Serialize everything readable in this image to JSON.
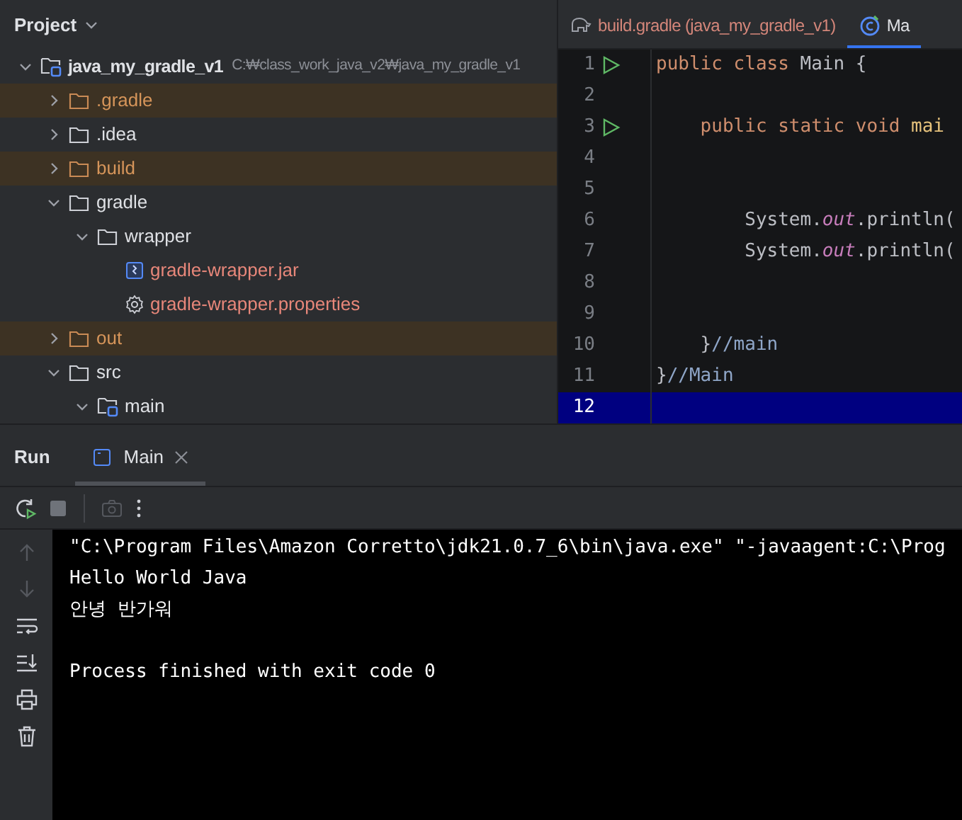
{
  "project_panel": {
    "title": "Project",
    "tree": [
      {
        "name": "java_my_gradle_v1",
        "kind": "module",
        "path": "C:₩class_work_java_v2₩java_my_gradle_v1",
        "excluded": false,
        "expanded": true,
        "children": [
          {
            "name": ".gradle",
            "kind": "folder",
            "excluded": true,
            "expanded": false
          },
          {
            "name": ".idea",
            "kind": "folder",
            "excluded": false,
            "expanded": false
          },
          {
            "name": "build",
            "kind": "folder",
            "excluded": true,
            "expanded": false
          },
          {
            "name": "gradle",
            "kind": "folder",
            "excluded": false,
            "expanded": true,
            "children": [
              {
                "name": "wrapper",
                "kind": "folder",
                "excluded": false,
                "expanded": true,
                "children": [
                  {
                    "name": "gradle-wrapper.jar",
                    "kind": "jar",
                    "excluded": false,
                    "unversioned": true
                  },
                  {
                    "name": "gradle-wrapper.properties",
                    "kind": "properties",
                    "excluded": false,
                    "unversioned": true
                  }
                ]
              }
            ]
          },
          {
            "name": "out",
            "kind": "folder",
            "excluded": true,
            "expanded": false
          },
          {
            "name": "src",
            "kind": "folder",
            "excluded": false,
            "expanded": true,
            "children": [
              {
                "name": "main",
                "kind": "source",
                "excluded": false,
                "expanded": true
              }
            ]
          }
        ]
      }
    ]
  },
  "editor": {
    "tabs": [
      {
        "label": "build.gradle (java_my_gradle_v1)",
        "selected": false
      },
      {
        "label": "Ma",
        "selected": true
      }
    ],
    "lines": [
      {
        "number": "1",
        "runnable": true,
        "current": false,
        "tokens": [
          {
            "text": "public class",
            "kind": "keyword"
          },
          {
            "text": " Main {",
            "kind": "plain"
          }
        ]
      },
      {
        "number": "2",
        "runnable": false,
        "current": false
      },
      {
        "number": "3",
        "runnable": true,
        "current": false,
        "tokens": [
          {
            "text": "    public static void",
            "kind": "keyword"
          },
          {
            "text": " mai",
            "kind": "method"
          }
        ]
      },
      {
        "number": "4",
        "runnable": false,
        "current": false
      },
      {
        "number": "5",
        "runnable": false,
        "current": false
      },
      {
        "number": "6",
        "runnable": false,
        "current": false,
        "tokens": [
          {
            "text": "        System.",
            "kind": "plain"
          },
          {
            "text": "out",
            "kind": "static"
          },
          {
            "text": ".println(",
            "kind": "plain"
          }
        ]
      },
      {
        "number": "7",
        "runnable": false,
        "current": false,
        "tokens": [
          {
            "text": "        System.",
            "kind": "plain"
          },
          {
            "text": "out",
            "kind": "static"
          },
          {
            "text": ".println(",
            "kind": "plain"
          }
        ]
      },
      {
        "number": "8",
        "runnable": false,
        "current": false
      },
      {
        "number": "9",
        "runnable": false,
        "current": false
      },
      {
        "number": "10",
        "runnable": false,
        "current": false,
        "tokens": [
          {
            "text": "    }",
            "kind": "plain"
          },
          {
            "text": "//main",
            "kind": "comment"
          }
        ]
      },
      {
        "number": "11",
        "runnable": false,
        "current": false,
        "tokens": [
          {
            "text": "}",
            "kind": "plain"
          },
          {
            "text": "//Main",
            "kind": "comment"
          }
        ]
      },
      {
        "number": "12",
        "runnable": false,
        "current": true
      }
    ]
  },
  "run_panel": {
    "title": "Run",
    "tabs": [
      {
        "label": "Main",
        "selected": true,
        "closable": true
      }
    ],
    "toolbar": [
      {
        "kind": "rerun",
        "disabled": false
      },
      {
        "kind": "stop",
        "disabled": false
      },
      {
        "kind": "screenshot",
        "disabled": true
      },
      {
        "kind": "more",
        "disabled": false
      }
    ],
    "side_toolbar": [
      {
        "kind": "up",
        "disabled": true
      },
      {
        "kind": "down",
        "disabled": true
      },
      {
        "kind": "wrap",
        "disabled": false
      },
      {
        "kind": "scroll_end",
        "disabled": false
      },
      {
        "kind": "print",
        "disabled": false
      },
      {
        "kind": "clear",
        "disabled": false
      }
    ],
    "console_blocks": [
      [
        "\"C:\\Program Files\\Amazon Corretto\\jdk21.0.7_6\\bin\\java.exe\" \"-javaagent:C:\\Prog",
        "Hello World Java",
        "안녕 반가워"
      ],
      [
        "Process finished with exit code 0"
      ]
    ]
  }
}
